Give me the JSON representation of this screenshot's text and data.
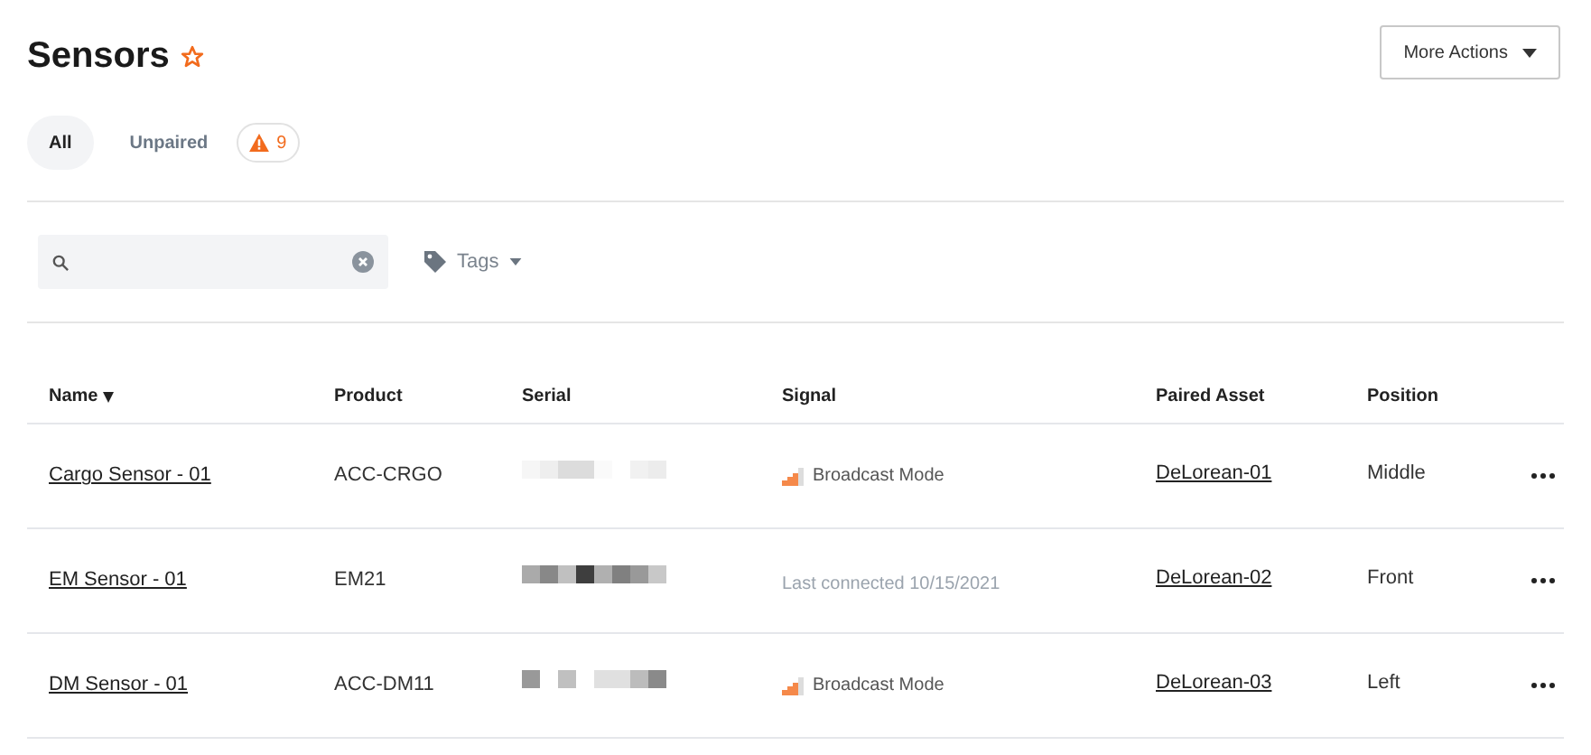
{
  "header": {
    "title": "Sensors",
    "favorite": false,
    "more_actions": "More Actions"
  },
  "tabs": [
    {
      "label": "All",
      "selected": true
    },
    {
      "label": "Unpaired",
      "selected": false,
      "badge": "9"
    }
  ],
  "filters": {
    "tags": "Tags"
  },
  "table": {
    "columns": [
      {
        "label": "Name",
        "sorted": true
      },
      {
        "label": "Product",
        "sorted": false
      },
      {
        "label": "Serial",
        "sorted": false
      },
      {
        "label": "Signal",
        "sorted": false
      },
      {
        "label": "Paired Asset",
        "sorted": false
      },
      {
        "label": "Position",
        "sorted": false
      }
    ],
    "rows": [
      {
        "name": "Cargo Sensor - 01",
        "product": "ACC-CRGO",
        "signal": {
          "kind": "broadcast",
          "text": "Broadcast Mode"
        },
        "asset": "DeLorean-01",
        "position": "Middle"
      },
      {
        "name": "EM Sensor - 01",
        "product": "EM21",
        "signal": {
          "kind": "last_seen",
          "text": "Last connected 10/15/2021"
        },
        "asset": "DeLorean-02",
        "position": "Front"
      },
      {
        "name": "DM Sensor - 01",
        "product": "ACC-DM11",
        "signal": {
          "kind": "broadcast",
          "text": "Broadcast Mode"
        },
        "asset": "DeLorean-03",
        "position": "Left"
      }
    ]
  }
}
